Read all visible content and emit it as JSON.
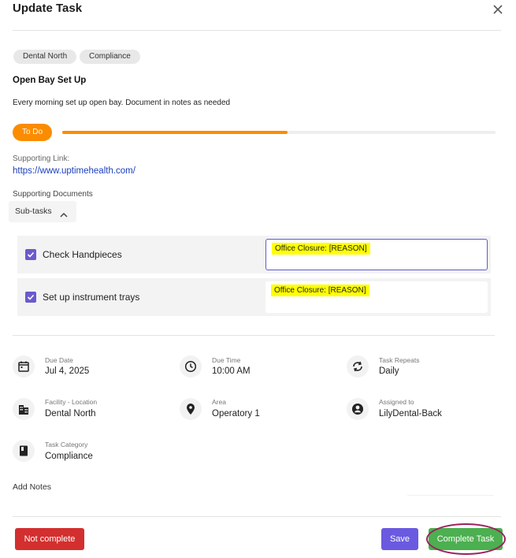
{
  "dialog": {
    "title": "Update Task"
  },
  "tags": [
    "Dental North",
    "Compliance"
  ],
  "task": {
    "name": "Open Bay Set Up",
    "description": "Every morning set up open bay. Document in notes as needed",
    "status": "To Do",
    "progress_percent": 52,
    "status_color": "#fb8c00"
  },
  "supporting": {
    "link_label": "Supporting Link:",
    "link_url": "https://www.uptimehealth.com/",
    "documents_label": "Supporting Documents"
  },
  "subtasks": {
    "toggle_label": "Sub-tasks",
    "items": [
      {
        "label": "Check Handpieces",
        "checked": true,
        "note": "Office Closure: [REASON]"
      },
      {
        "label": "Set up instrument trays",
        "checked": true,
        "note": "Office Closure: [REASON]"
      }
    ]
  },
  "details": {
    "due_date": {
      "label": "Due Date",
      "value": "Jul 4, 2025",
      "icon": "calendar-icon"
    },
    "due_time": {
      "label": "Due Time",
      "value": "10:00 AM",
      "icon": "clock-icon"
    },
    "repeats": {
      "label": "Task Repeats",
      "value": "Daily",
      "icon": "repeat-icon"
    },
    "facility": {
      "label": "Facility - Location",
      "value": "Dental North",
      "icon": "building-icon"
    },
    "area": {
      "label": "Area",
      "value": "Operatory 1",
      "icon": "location-pin-icon"
    },
    "assigned": {
      "label": "Assigned to",
      "value": "LilyDental-Back",
      "icon": "account-circle-icon"
    },
    "category": {
      "label": "Task Category",
      "value": "Compliance",
      "icon": "book-icon"
    }
  },
  "notes": {
    "label": "Add Notes"
  },
  "actions": {
    "not_complete": "Not complete",
    "save": "Save",
    "complete": "Complete Task"
  },
  "colors": {
    "accent": "#6a5ae0",
    "danger": "#d32f2f",
    "success": "#4caf50",
    "highlight": "#ffff00"
  }
}
